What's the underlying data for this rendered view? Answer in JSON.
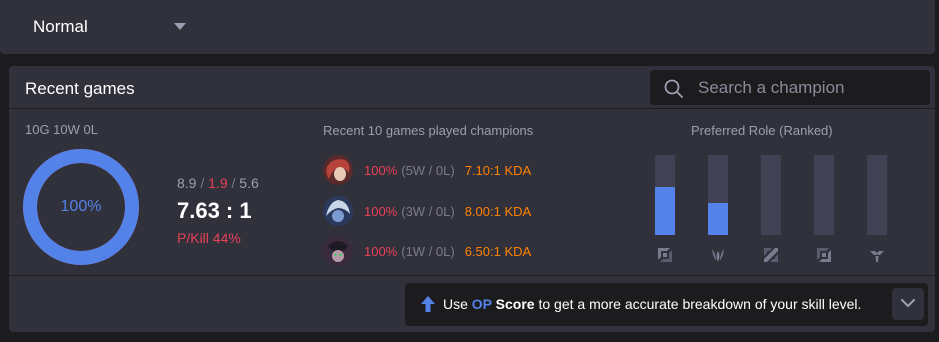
{
  "queue": {
    "selected": "Normal"
  },
  "recent": {
    "title": "Recent games",
    "search_placeholder": "Search a champion",
    "record": "10G 10W 0L",
    "win_rate": {
      "label": "100%",
      "value": 1.0
    },
    "kda": {
      "kills": "8.9",
      "deaths": "1.9",
      "assists": "5.6",
      "ratio": "7.63 : 1"
    },
    "pkill": "P/Kill 44%",
    "champions_title": "Recent 10 games played champions",
    "champions": [
      {
        "winrate": "100%",
        "record": "(5W / 0L)",
        "kda": "7.10:1 KDA",
        "icon": "champion-portrait-red"
      },
      {
        "winrate": "100%",
        "record": "(3W / 0L)",
        "kda": "8.00:1 KDA",
        "icon": "champion-portrait-blue"
      },
      {
        "winrate": "100%",
        "record": "(1W / 0L)",
        "kda": "6.50:1 KDA",
        "icon": "champion-portrait-purple"
      }
    ],
    "role_title": "Preferred Role (Ranked)",
    "roles": [
      {
        "name": "top",
        "share": 0.6,
        "icon": "top-lane-icon"
      },
      {
        "name": "jungle",
        "share": 0.4,
        "icon": "jungle-icon"
      },
      {
        "name": "mid",
        "share": 0.0,
        "icon": "mid-lane-icon"
      },
      {
        "name": "bottom",
        "share": 0.0,
        "icon": "bottom-lane-icon"
      },
      {
        "name": "support",
        "share": 0.0,
        "icon": "support-icon"
      }
    ],
    "tip": {
      "prefix": "Use ",
      "op": "OP",
      "score": " Score",
      "suffix": " to get a more accurate breakdown of your skill level."
    }
  },
  "colors": {
    "accent": "#5383e8",
    "loss_red": "#e84057",
    "kda_orange": "#ff8200",
    "panel": "#31313c",
    "background": "#1c1c1f"
  }
}
